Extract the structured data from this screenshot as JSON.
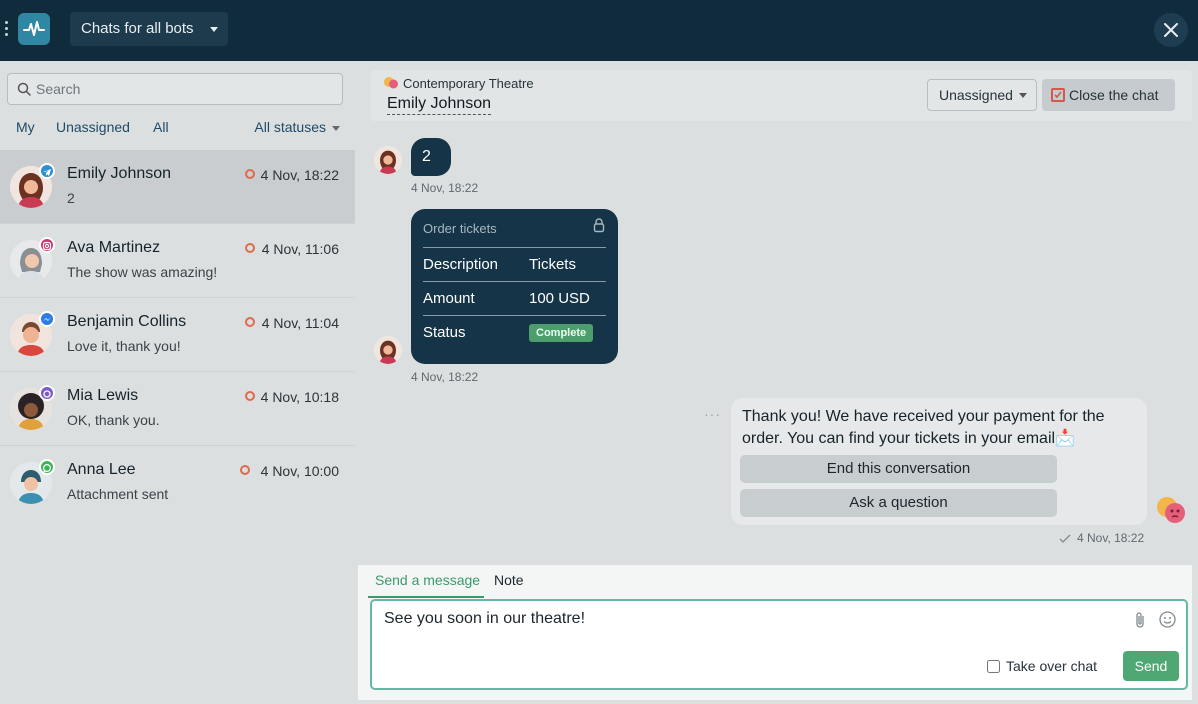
{
  "app": {
    "bot_selector": "Chats for all bots"
  },
  "sidebar": {
    "search_placeholder": "Search",
    "filters": [
      "My",
      "Unassigned",
      "All"
    ],
    "status_filter": "All statuses",
    "chats": [
      {
        "name": "Emily Johnson",
        "message": "2",
        "time": "4 Nov, 18:22",
        "channel": "telegram-icon",
        "channel_color": "#2f8fcf"
      },
      {
        "name": "Ava Martinez",
        "message": "The show was amazing!",
        "time": "4 Nov, 11:06",
        "channel": "instagram-icon",
        "channel_color": "#d6336c"
      },
      {
        "name": "Benjamin Collins",
        "message": "Love it, thank you!",
        "time": "4 Nov, 11:04",
        "channel": "messenger-icon",
        "channel_color": "#2d7be5"
      },
      {
        "name": "Mia Lewis",
        "message": "OK, thank you.",
        "time": "4 Nov, 10:18",
        "channel": "viber-icon",
        "channel_color": "#7a5bc9"
      },
      {
        "name": "Anna Lee",
        "message": "Attachment sent",
        "time": "4 Nov, 10:00",
        "channel": "whatsapp-icon",
        "channel_color": "#3cb55a"
      }
    ]
  },
  "chat": {
    "organization": "Contemporary Theatre",
    "contact_name": "Emily Johnson",
    "assign_label": "Unassigned",
    "close_label": "Close the chat",
    "messages": {
      "first_text": "2",
      "first_time": "4 Nov, 18:22",
      "order": {
        "title": "Order tickets",
        "rows": [
          {
            "key": "Description",
            "value": "Tickets"
          },
          {
            "key": "Amount",
            "value": "100 USD"
          },
          {
            "key": "Status",
            "value": "Complete"
          }
        ],
        "time": "4 Nov, 18:22"
      },
      "outgoing": {
        "text": "Thank you! We have received your payment for the order. You can find your tickets in your email📩",
        "buttons": [
          "End this conversation",
          "Ask a question"
        ],
        "time": "4 Nov, 18:22"
      }
    }
  },
  "composer": {
    "tab_message": "Send a message",
    "tab_note": "Note",
    "text": "See you soon in our theatre!",
    "takeover_label": "Take over chat",
    "send_label": "Send"
  },
  "colors": {
    "topbar": "#102b3c",
    "accent_green": "#4fa873",
    "bubble_dark": "#163447",
    "unread_dot": "#e06a4c"
  }
}
